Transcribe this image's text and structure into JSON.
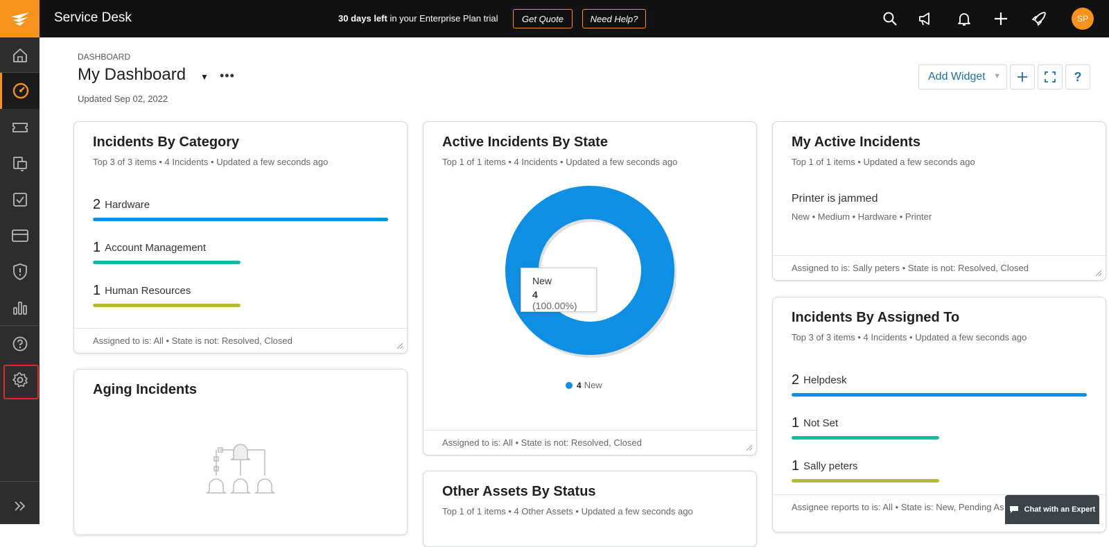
{
  "topbar": {
    "app_title": "Service Desk",
    "trial_bold": "30 days left",
    "trial_text": " in your Enterprise Plan trial",
    "get_quote": "Get Quote",
    "need_help": "Need Help?",
    "avatar_initials": "SP",
    "icons": [
      "search-icon",
      "announcement-icon",
      "bell-icon",
      "plus-icon",
      "rocket-icon"
    ]
  },
  "sidebar": {
    "items": [
      "home",
      "dashboard",
      "tickets",
      "assets",
      "tasks",
      "billing",
      "security",
      "reports",
      "help",
      "settings"
    ],
    "expand": "expand"
  },
  "header": {
    "breadcrumb": "DASHBOARD",
    "title": "My Dashboard",
    "updated": "Updated Sep 02, 2022",
    "add_widget": "Add Widget"
  },
  "cards": {
    "incidents_by_category": {
      "title": "Incidents By Category",
      "subtitle": "Top 3 of 3 items • 4 Incidents • Updated a few seconds ago",
      "rows": [
        {
          "count": "2",
          "label": "Hardware",
          "fraction": 1.0,
          "color": "#0f8fe3"
        },
        {
          "count": "1",
          "label": "Account Management",
          "fraction": 0.5,
          "color": "#1ab8a3"
        },
        {
          "count": "1",
          "label": "Human Resources",
          "fraction": 0.5,
          "color": "#b5bd2a"
        }
      ],
      "footer": "Assigned to is: All • State is not: Resolved, Closed"
    },
    "aging_incidents": {
      "title": "Aging Incidents"
    },
    "active_incidents_by_state": {
      "title": "Active Incidents By State",
      "subtitle": "Top 1 of 1 items • 4 Incidents • Updated a few seconds ago",
      "tooltip_label": "New",
      "tooltip_count": "4",
      "tooltip_pct": " (100.00%)",
      "legend_count": "4",
      "legend_label": "New",
      "footer": "Assigned to is: All • State is not: Resolved, Closed"
    },
    "other_assets_by_status": {
      "title": "Other Assets By Status",
      "subtitle": "Top 1 of 1 items • 4 Other Assets • Updated a few seconds ago"
    },
    "my_active_incidents": {
      "title": "My Active Incidents",
      "subtitle": "Top 1 of 1 items • Updated a few seconds ago",
      "incident_title": "Printer is jammed",
      "incident_meta": "New • Medium • Hardware • Printer",
      "footer": "Assigned to is: Sally peters • State is not: Resolved, Closed"
    },
    "incidents_by_assigned_to": {
      "title": "Incidents By Assigned To",
      "subtitle": "Top 3 of 3 items • 4 Incidents • Updated a few seconds ago",
      "rows": [
        {
          "count": "2",
          "label": "Helpdesk",
          "fraction": 1.0,
          "color": "#0f8fe3"
        },
        {
          "count": "1",
          "label": "Not Set",
          "fraction": 0.5,
          "color": "#1ab8a3"
        },
        {
          "count": "1",
          "label": "Sally peters",
          "fraction": 0.5,
          "color": "#b5bd2a"
        }
      ],
      "footer": "Assignee reports to is: All • State is: New, Pending As"
    }
  },
  "chat": {
    "label": "Chat with an Expert"
  },
  "colors": {
    "accent": "#f6921e",
    "donut": "#0f8fe3",
    "highlight": "#e2282b"
  },
  "chart_data": {
    "type": "pie",
    "categories": [
      "New"
    ],
    "values": [
      4
    ],
    "title": "Active Incidents By State"
  }
}
